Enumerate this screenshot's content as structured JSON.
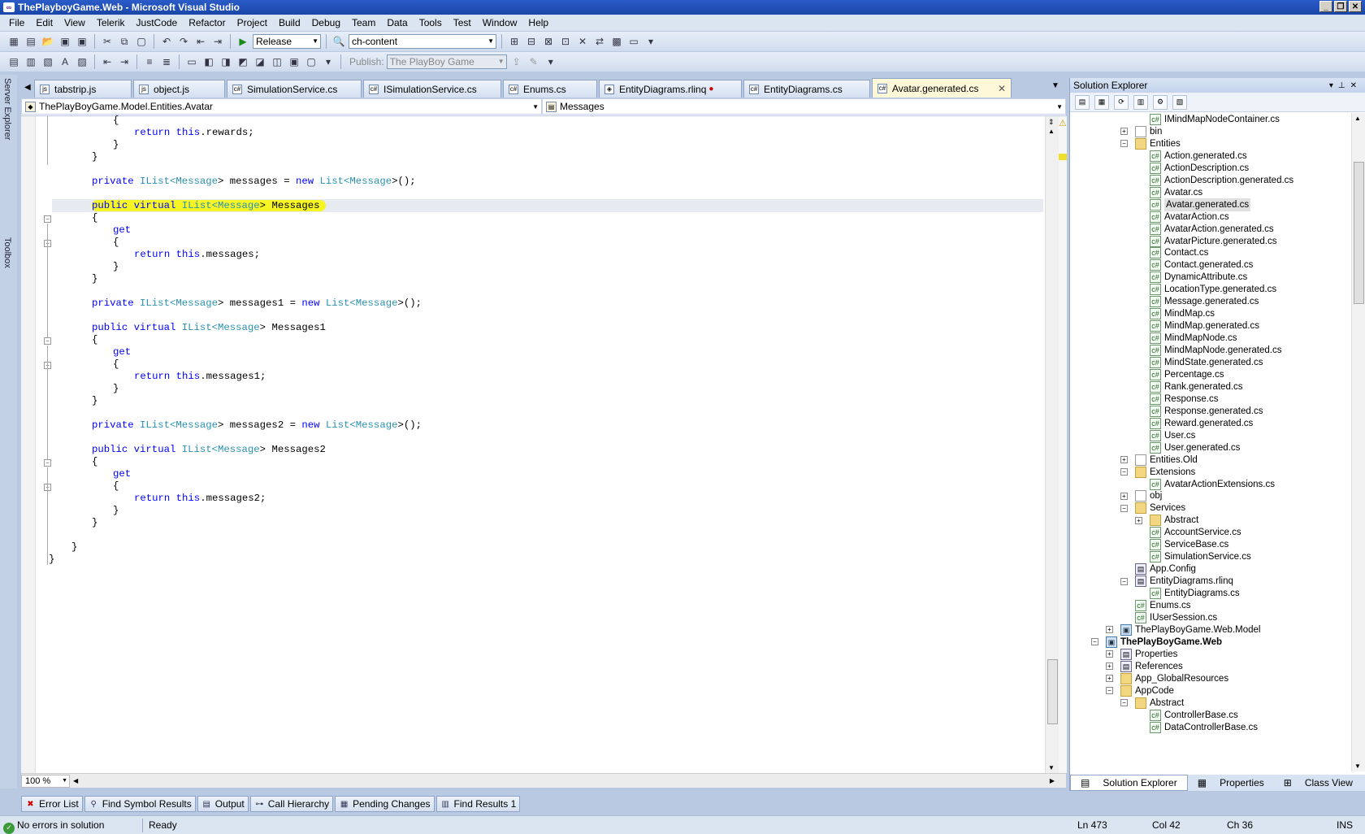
{
  "window": {
    "title": "ThePlayboyGame.Web - Microsoft Visual Studio"
  },
  "menu": [
    "File",
    "Edit",
    "View",
    "Telerik",
    "JustCode",
    "Refactor",
    "Project",
    "Build",
    "Debug",
    "Team",
    "Data",
    "Tools",
    "Test",
    "Window",
    "Help"
  ],
  "toolbar": {
    "config": "Release",
    "find": "ch-content",
    "publish_label": "Publish:",
    "publish_value": "The PlayBoy Game"
  },
  "side_tabs": [
    "Server Explorer",
    "Toolbox"
  ],
  "doc_tabs": [
    {
      "label": "tabstrip.js"
    },
    {
      "label": "object.js"
    },
    {
      "label": "SimulationService.cs"
    },
    {
      "label": "ISimulationService.cs"
    },
    {
      "label": "Enums.cs"
    },
    {
      "label": "EntityDiagrams.rlinq"
    },
    {
      "label": "EntityDiagrams.cs"
    },
    {
      "label": "Avatar.generated.cs"
    }
  ],
  "nav": {
    "type": "ThePlayBoyGame.Model.Entities.Avatar",
    "member": "Messages"
  },
  "code_lines": [
    {
      "l1": "{"
    },
    {
      "l2": "return",
      "l3": " ",
      "l4": "this",
      "l5": ".rewards;"
    },
    {
      "l6": "}"
    },
    {
      "l7": "}"
    },
    {
      "m1": "private",
      "m2": "IList",
      "m3": "Message",
      "m4": "messages = ",
      "m5": "new",
      "m6": "List",
      "m7": "Message",
      "m8": ">();"
    }
  ],
  "code": {
    "rewards_open": "{",
    "rewards_ret_kw": "return",
    "rewards_this": "this",
    "rewards_rest": ".rewards;",
    "rewards_close1": "}",
    "rewards_close2": "}",
    "kw_private": "private",
    "kw_public": "public",
    "kw_virtual": "virtual",
    "kw_new": "new",
    "kw_get": "get",
    "kw_return": "return",
    "kw_this": "this",
    "ty_ilist": "IList",
    "ty_list": "List",
    "ty_message": "Message",
    "lt": "<",
    "gt": ">",
    "f0": "messages",
    "f1": "messages1",
    "f2": "messages2",
    "p0": "Messages",
    "p1": "Messages1",
    "p2": "Messages2",
    "eq": " = ",
    "tail": ">();",
    "open": "{",
    "close": "}",
    "semi": ";",
    "dot": "."
  },
  "editor": {
    "zoom": "100 %"
  },
  "bottom_tabs": [
    "Error List",
    "Find Symbol Results",
    "Output",
    "Call Hierarchy",
    "Pending Changes",
    "Find Results 1"
  ],
  "status": {
    "errors": "No errors in solution",
    "state": "Ready",
    "ln": "Ln 473",
    "col": "Col 42",
    "ch": "Ch 36",
    "ins": "INS"
  },
  "solution_explorer": {
    "title": "Solution Explorer",
    "bottom_tabs": [
      "Solution Explorer",
      "Properties",
      "Class View"
    ],
    "nodes": [
      {
        "label": "IMindMapNodeContainer.cs",
        "indent": 4,
        "icon": "file",
        "exp": ""
      },
      {
        "label": "bin",
        "indent": 3,
        "icon": "folderw",
        "exp": "+"
      },
      {
        "label": "Entities",
        "indent": 3,
        "icon": "folder",
        "exp": "-"
      },
      {
        "label": "Action.generated.cs",
        "indent": 4,
        "icon": "file",
        "exp": ""
      },
      {
        "label": "ActionDescription.cs",
        "indent": 4,
        "icon": "file",
        "exp": ""
      },
      {
        "label": "ActionDescription.generated.cs",
        "indent": 4,
        "icon": "file",
        "exp": ""
      },
      {
        "label": "Avatar.cs",
        "indent": 4,
        "icon": "file",
        "exp": ""
      },
      {
        "label": "Avatar.generated.cs",
        "indent": 4,
        "icon": "file",
        "exp": "",
        "sel": true
      },
      {
        "label": "AvatarAction.cs",
        "indent": 4,
        "icon": "file",
        "exp": ""
      },
      {
        "label": "AvatarAction.generated.cs",
        "indent": 4,
        "icon": "file",
        "exp": ""
      },
      {
        "label": "AvatarPicture.generated.cs",
        "indent": 4,
        "icon": "file",
        "exp": ""
      },
      {
        "label": "Contact.cs",
        "indent": 4,
        "icon": "file",
        "exp": ""
      },
      {
        "label": "Contact.generated.cs",
        "indent": 4,
        "icon": "file",
        "exp": ""
      },
      {
        "label": "DynamicAttribute.cs",
        "indent": 4,
        "icon": "file",
        "exp": ""
      },
      {
        "label": "LocationType.generated.cs",
        "indent": 4,
        "icon": "file",
        "exp": ""
      },
      {
        "label": "Message.generated.cs",
        "indent": 4,
        "icon": "file",
        "exp": ""
      },
      {
        "label": "MindMap.cs",
        "indent": 4,
        "icon": "file",
        "exp": ""
      },
      {
        "label": "MindMap.generated.cs",
        "indent": 4,
        "icon": "file",
        "exp": ""
      },
      {
        "label": "MindMapNode.cs",
        "indent": 4,
        "icon": "file",
        "exp": ""
      },
      {
        "label": "MindMapNode.generated.cs",
        "indent": 4,
        "icon": "file",
        "exp": ""
      },
      {
        "label": "MindState.generated.cs",
        "indent": 4,
        "icon": "file",
        "exp": ""
      },
      {
        "label": "Percentage.cs",
        "indent": 4,
        "icon": "file",
        "exp": ""
      },
      {
        "label": "Rank.generated.cs",
        "indent": 4,
        "icon": "file",
        "exp": ""
      },
      {
        "label": "Response.cs",
        "indent": 4,
        "icon": "file",
        "exp": ""
      },
      {
        "label": "Response.generated.cs",
        "indent": 4,
        "icon": "file",
        "exp": ""
      },
      {
        "label": "Reward.generated.cs",
        "indent": 4,
        "icon": "file",
        "exp": ""
      },
      {
        "label": "User.cs",
        "indent": 4,
        "icon": "file",
        "exp": ""
      },
      {
        "label": "User.generated.cs",
        "indent": 4,
        "icon": "file",
        "exp": ""
      },
      {
        "label": "Entities.Old",
        "indent": 3,
        "icon": "folderw",
        "exp": "+"
      },
      {
        "label": "Extensions",
        "indent": 3,
        "icon": "folder",
        "exp": "-"
      },
      {
        "label": "AvatarActionExtensions.cs",
        "indent": 4,
        "icon": "file",
        "exp": ""
      },
      {
        "label": "obj",
        "indent": 3,
        "icon": "folderw",
        "exp": "+"
      },
      {
        "label": "Services",
        "indent": 3,
        "icon": "folder",
        "exp": "-"
      },
      {
        "label": "Abstract",
        "indent": 4,
        "icon": "folder",
        "exp": "+"
      },
      {
        "label": "AccountService.cs",
        "indent": 4,
        "icon": "file",
        "exp": ""
      },
      {
        "label": "ServiceBase.cs",
        "indent": 4,
        "icon": "file",
        "exp": ""
      },
      {
        "label": "SimulationService.cs",
        "indent": 4,
        "icon": "file",
        "exp": ""
      },
      {
        "label": "App.Config",
        "indent": 3,
        "icon": "cfg",
        "exp": ""
      },
      {
        "label": "EntityDiagrams.rlinq",
        "indent": 3,
        "icon": "cfg",
        "exp": "-"
      },
      {
        "label": "EntityDiagrams.cs",
        "indent": 4,
        "icon": "file",
        "exp": ""
      },
      {
        "label": "Enums.cs",
        "indent": 3,
        "icon": "file",
        "exp": ""
      },
      {
        "label": "IUserSession.cs",
        "indent": 3,
        "icon": "file",
        "exp": ""
      },
      {
        "label": "ThePlayBoyGame.Web.Model",
        "indent": 2,
        "icon": "proj",
        "exp": "+"
      },
      {
        "label": "ThePlayBoyGame.Web",
        "indent": 1,
        "icon": "proj",
        "exp": "-",
        "bold": true
      },
      {
        "label": "Properties",
        "indent": 2,
        "icon": "cfg",
        "exp": "+"
      },
      {
        "label": "References",
        "indent": 2,
        "icon": "cfg",
        "exp": "+"
      },
      {
        "label": "App_GlobalResources",
        "indent": 2,
        "icon": "folder",
        "exp": "+"
      },
      {
        "label": "AppCode",
        "indent": 2,
        "icon": "folder",
        "exp": "-"
      },
      {
        "label": "Abstract",
        "indent": 3,
        "icon": "folder",
        "exp": "-"
      },
      {
        "label": "ControllerBase.cs",
        "indent": 4,
        "icon": "file",
        "exp": ""
      },
      {
        "label": "DataControllerBase.cs",
        "indent": 4,
        "icon": "file",
        "exp": ""
      }
    ]
  }
}
